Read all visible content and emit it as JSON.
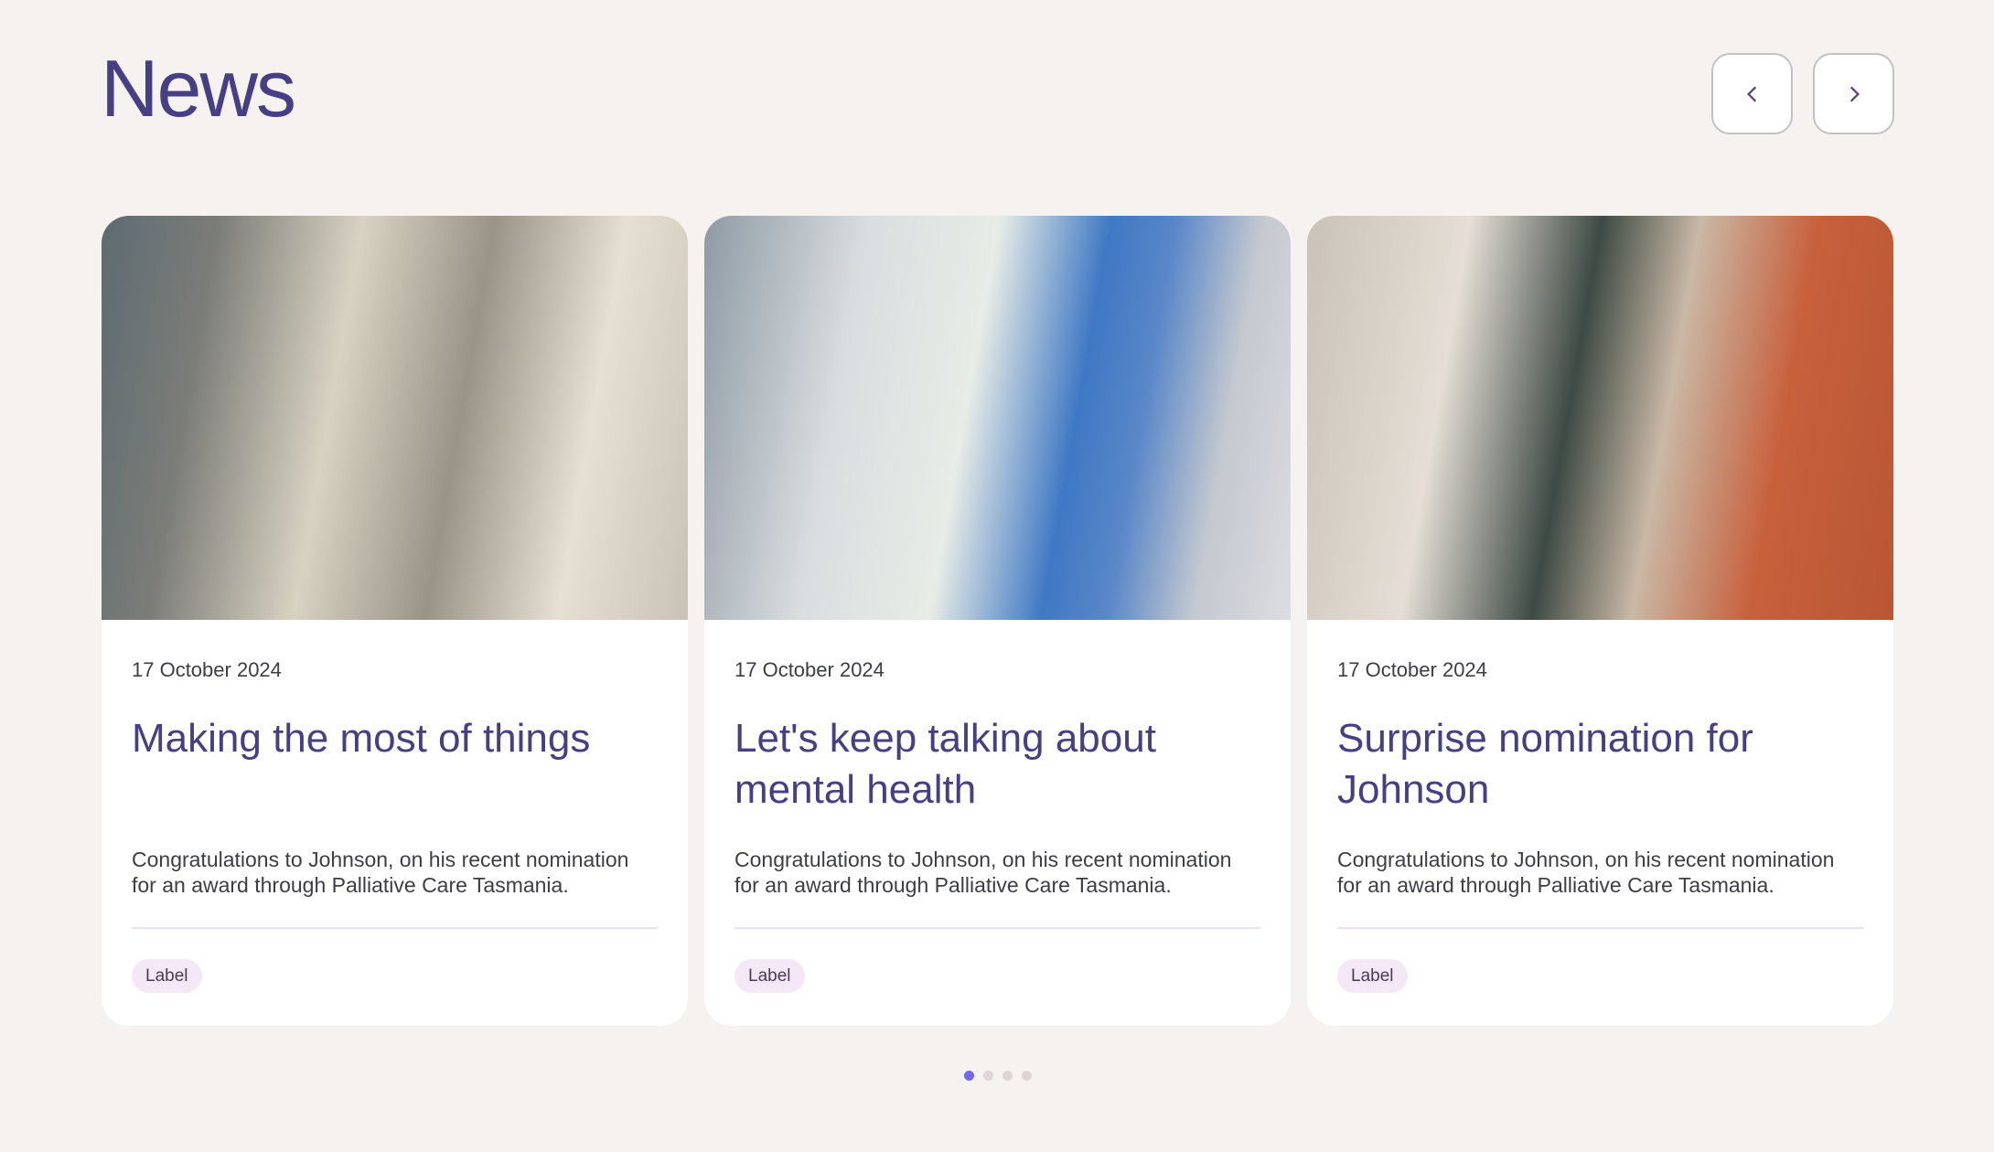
{
  "header": {
    "title": "News",
    "prev_icon": "chevron-left-icon",
    "next_icon": "chevron-right-icon"
  },
  "cards": [
    {
      "date": "17 October 2024",
      "title": "Making the most of things",
      "text": "Congratulations to Johnson, on his recent nomination for an award through Palliative Care Tasmania.",
      "label": "Label"
    },
    {
      "date": "17 October 2024",
      "title": "Let's keep talking about mental health",
      "text": "Congratulations to Johnson, on his recent nomination for an award through Palliative Care Tasmania.",
      "label": "Label"
    },
    {
      "date": "17 October 2024",
      "title": "Surprise nomination for Johnson",
      "text": "Congratulations to Johnson, on his recent nomination for an award through Palliative Care Tasmania.",
      "label": "Label"
    }
  ],
  "pagination": {
    "pages": 4,
    "current": 1
  },
  "colors": {
    "accent": "#463f86",
    "active_dot": "#7367f0",
    "background": "#f5f2ef"
  }
}
